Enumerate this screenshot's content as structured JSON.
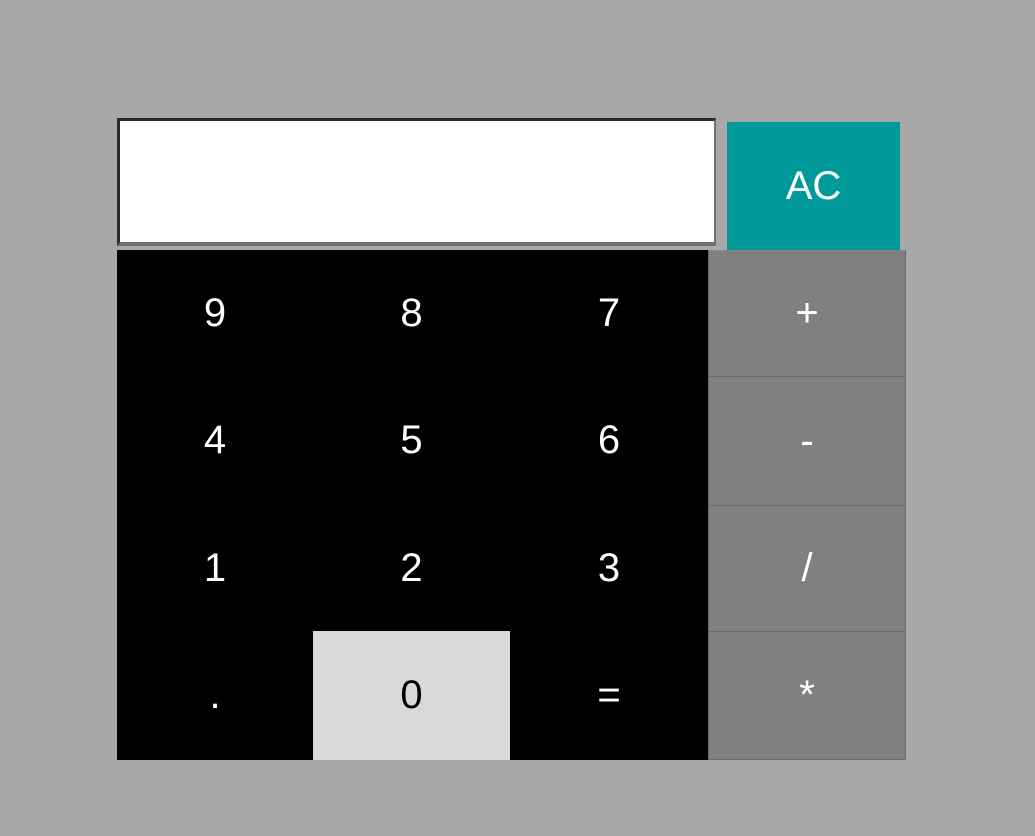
{
  "display": {
    "value": ""
  },
  "clear_button": {
    "label": "AC"
  },
  "keys": {
    "row1": [
      "9",
      "8",
      "7",
      "+"
    ],
    "row2": [
      "4",
      "5",
      "6",
      "-"
    ],
    "row3": [
      "1",
      "2",
      "3",
      "/"
    ],
    "row4": [
      ".",
      "0",
      "=",
      "*"
    ]
  },
  "colors": {
    "background": "#a8a8a8",
    "display_bg": "#ffffff",
    "clear_button_bg": "#009999",
    "number_key_bg": "#000000",
    "zero_key_bg": "#d9d9d9",
    "operator_key_bg": "#808080",
    "key_text": "#ffffff"
  }
}
